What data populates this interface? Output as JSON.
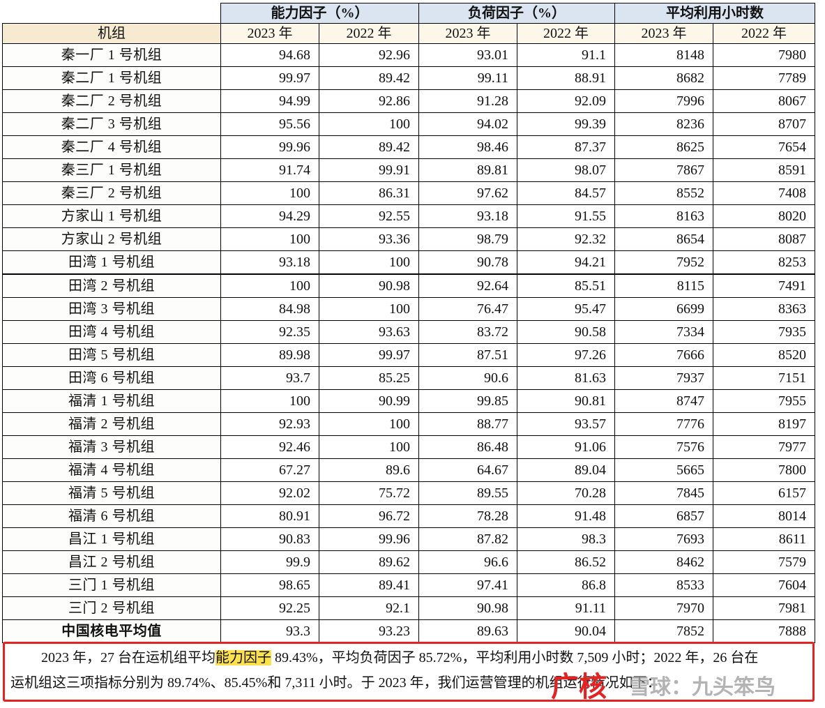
{
  "table": {
    "group_headers": [
      "能力因子（%）",
      "负荷因子（%）",
      "平均利用小时数"
    ],
    "unit_label": "机组",
    "year_labels": [
      "2023 年",
      "2022 年",
      "2023 年",
      "2022 年",
      "2023 年",
      "2022 年"
    ],
    "rows": [
      {
        "name": "秦一厂 1 号机组",
        "cf23": "94.68",
        "cf22": "92.96",
        "lf23": "93.01",
        "lf22": "91.1",
        "h23": "8148",
        "h22": "7980"
      },
      {
        "name": "秦二厂 1 号机组",
        "cf23": "99.97",
        "cf22": "89.42",
        "lf23": "99.11",
        "lf22": "88.91",
        "h23": "8682",
        "h22": "7789"
      },
      {
        "name": "秦二厂 2 号机组",
        "cf23": "94.99",
        "cf22": "92.86",
        "lf23": "91.28",
        "lf22": "92.09",
        "h23": "7996",
        "h22": "8067"
      },
      {
        "name": "秦二厂 3 号机组",
        "cf23": "95.56",
        "cf22": "100",
        "lf23": "94.02",
        "lf22": "99.39",
        "h23": "8236",
        "h22": "8707"
      },
      {
        "name": "秦二厂 4 号机组",
        "cf23": "99.96",
        "cf22": "89.42",
        "lf23": "98.46",
        "lf22": "87.37",
        "h23": "8625",
        "h22": "7654"
      },
      {
        "name": "秦三厂 1 号机组",
        "cf23": "91.74",
        "cf22": "99.91",
        "lf23": "89.81",
        "lf22": "98.07",
        "h23": "7867",
        "h22": "8591"
      },
      {
        "name": "秦三厂 2 号机组",
        "cf23": "100",
        "cf22": "86.31",
        "lf23": "97.62",
        "lf22": "84.57",
        "h23": "8552",
        "h22": "7408"
      },
      {
        "name": "方家山 1 号机组",
        "cf23": "94.29",
        "cf22": "92.55",
        "lf23": "93.18",
        "lf22": "91.55",
        "h23": "8163",
        "h22": "8020"
      },
      {
        "name": "方家山 2 号机组",
        "cf23": "100",
        "cf22": "93.36",
        "lf23": "98.79",
        "lf22": "92.32",
        "h23": "8654",
        "h22": "8087"
      },
      {
        "name": "田湾 1 号机组",
        "cf23": "93.18",
        "cf22": "100",
        "lf23": "90.78",
        "lf22": "94.21",
        "h23": "7952",
        "h22": "8253"
      },
      {
        "name": "田湾 2 号机组",
        "cf23": "100",
        "cf22": "90.98",
        "lf23": "92.64",
        "lf22": "85.51",
        "h23": "8115",
        "h22": "7491"
      },
      {
        "name": "田湾 3 号机组",
        "cf23": "84.98",
        "cf22": "100",
        "lf23": "76.47",
        "lf22": "95.47",
        "h23": "6699",
        "h22": "8363"
      },
      {
        "name": "田湾 4 号机组",
        "cf23": "92.35",
        "cf22": "93.63",
        "lf23": "83.72",
        "lf22": "90.58",
        "h23": "7334",
        "h22": "7935"
      },
      {
        "name": "田湾 5 号机组",
        "cf23": "89.98",
        "cf22": "99.97",
        "lf23": "87.51",
        "lf22": "97.26",
        "h23": "7666",
        "h22": "8520"
      },
      {
        "name": "田湾 6 号机组",
        "cf23": "93.7",
        "cf22": "85.25",
        "lf23": "90.6",
        "lf22": "81.63",
        "h23": "7937",
        "h22": "7151"
      },
      {
        "name": "福清 1 号机组",
        "cf23": "100",
        "cf22": "90.99",
        "lf23": "99.85",
        "lf22": "90.81",
        "h23": "8747",
        "h22": "7955"
      },
      {
        "name": "福清 2 号机组",
        "cf23": "92.93",
        "cf22": "100",
        "lf23": "88.77",
        "lf22": "93.57",
        "h23": "7776",
        "h22": "8197"
      },
      {
        "name": "福清 3 号机组",
        "cf23": "92.46",
        "cf22": "100",
        "lf23": "86.48",
        "lf22": "91.06",
        "h23": "7576",
        "h22": "7977"
      },
      {
        "name": "福清 4 号机组",
        "cf23": "67.27",
        "cf22": "89.6",
        "lf23": "64.67",
        "lf22": "89.04",
        "h23": "5665",
        "h22": "7800"
      },
      {
        "name": "福清 5 号机组",
        "cf23": "92.02",
        "cf22": "75.72",
        "lf23": "89.55",
        "lf22": "70.28",
        "h23": "7845",
        "h22": "6157"
      },
      {
        "name": "福清 6 号机组",
        "cf23": "80.91",
        "cf22": "96.72",
        "lf23": "78.28",
        "lf22": "91.48",
        "h23": "6857",
        "h22": "8014"
      },
      {
        "name": "昌江 1 号机组",
        "cf23": "90.83",
        "cf22": "99.96",
        "lf23": "87.82",
        "lf22": "98.3",
        "h23": "7693",
        "h22": "8611"
      },
      {
        "name": "昌江 2 号机组",
        "cf23": "99.9",
        "cf22": "89.62",
        "lf23": "96.6",
        "lf22": "86.52",
        "h23": "8462",
        "h22": "7579"
      },
      {
        "name": "三门 1 号机组",
        "cf23": "98.65",
        "cf22": "89.41",
        "lf23": "97.41",
        "lf22": "86.8",
        "h23": "8533",
        "h22": "7604"
      },
      {
        "name": "三门 2 号机组",
        "cf23": "92.25",
        "cf22": "92.1",
        "lf23": "90.98",
        "lf22": "91.11",
        "h23": "7970",
        "h22": "7981"
      },
      {
        "name": "中国核电平均值",
        "cf23": "93.3",
        "cf22": "93.23",
        "lf23": "89.63",
        "lf22": "90.04",
        "h23": "7852",
        "h22": "7888"
      }
    ]
  },
  "note": {
    "line1_pre": "2023 年，27 台在运机组平均",
    "line1_highlight": "能力因子",
    "line1_post": " 89.43%，平均负荷因子 85.72%，平均利用小时数 7,509 小时；2022 年，26 台在",
    "line2": "运机组这三项指标分别为 89.74%、85.45%和 7,311 小时。于 2023 年，我们运营管理的机组运行情况如下："
  },
  "watermark": {
    "red_text": "广核",
    "grey_text": "雪球：九头笨鸟"
  },
  "colors": {
    "header_bg": "#dbe5f1",
    "subheader_bg": "#fdf7e9",
    "highlight": "#ffe14d",
    "note_border": "#e32222"
  }
}
